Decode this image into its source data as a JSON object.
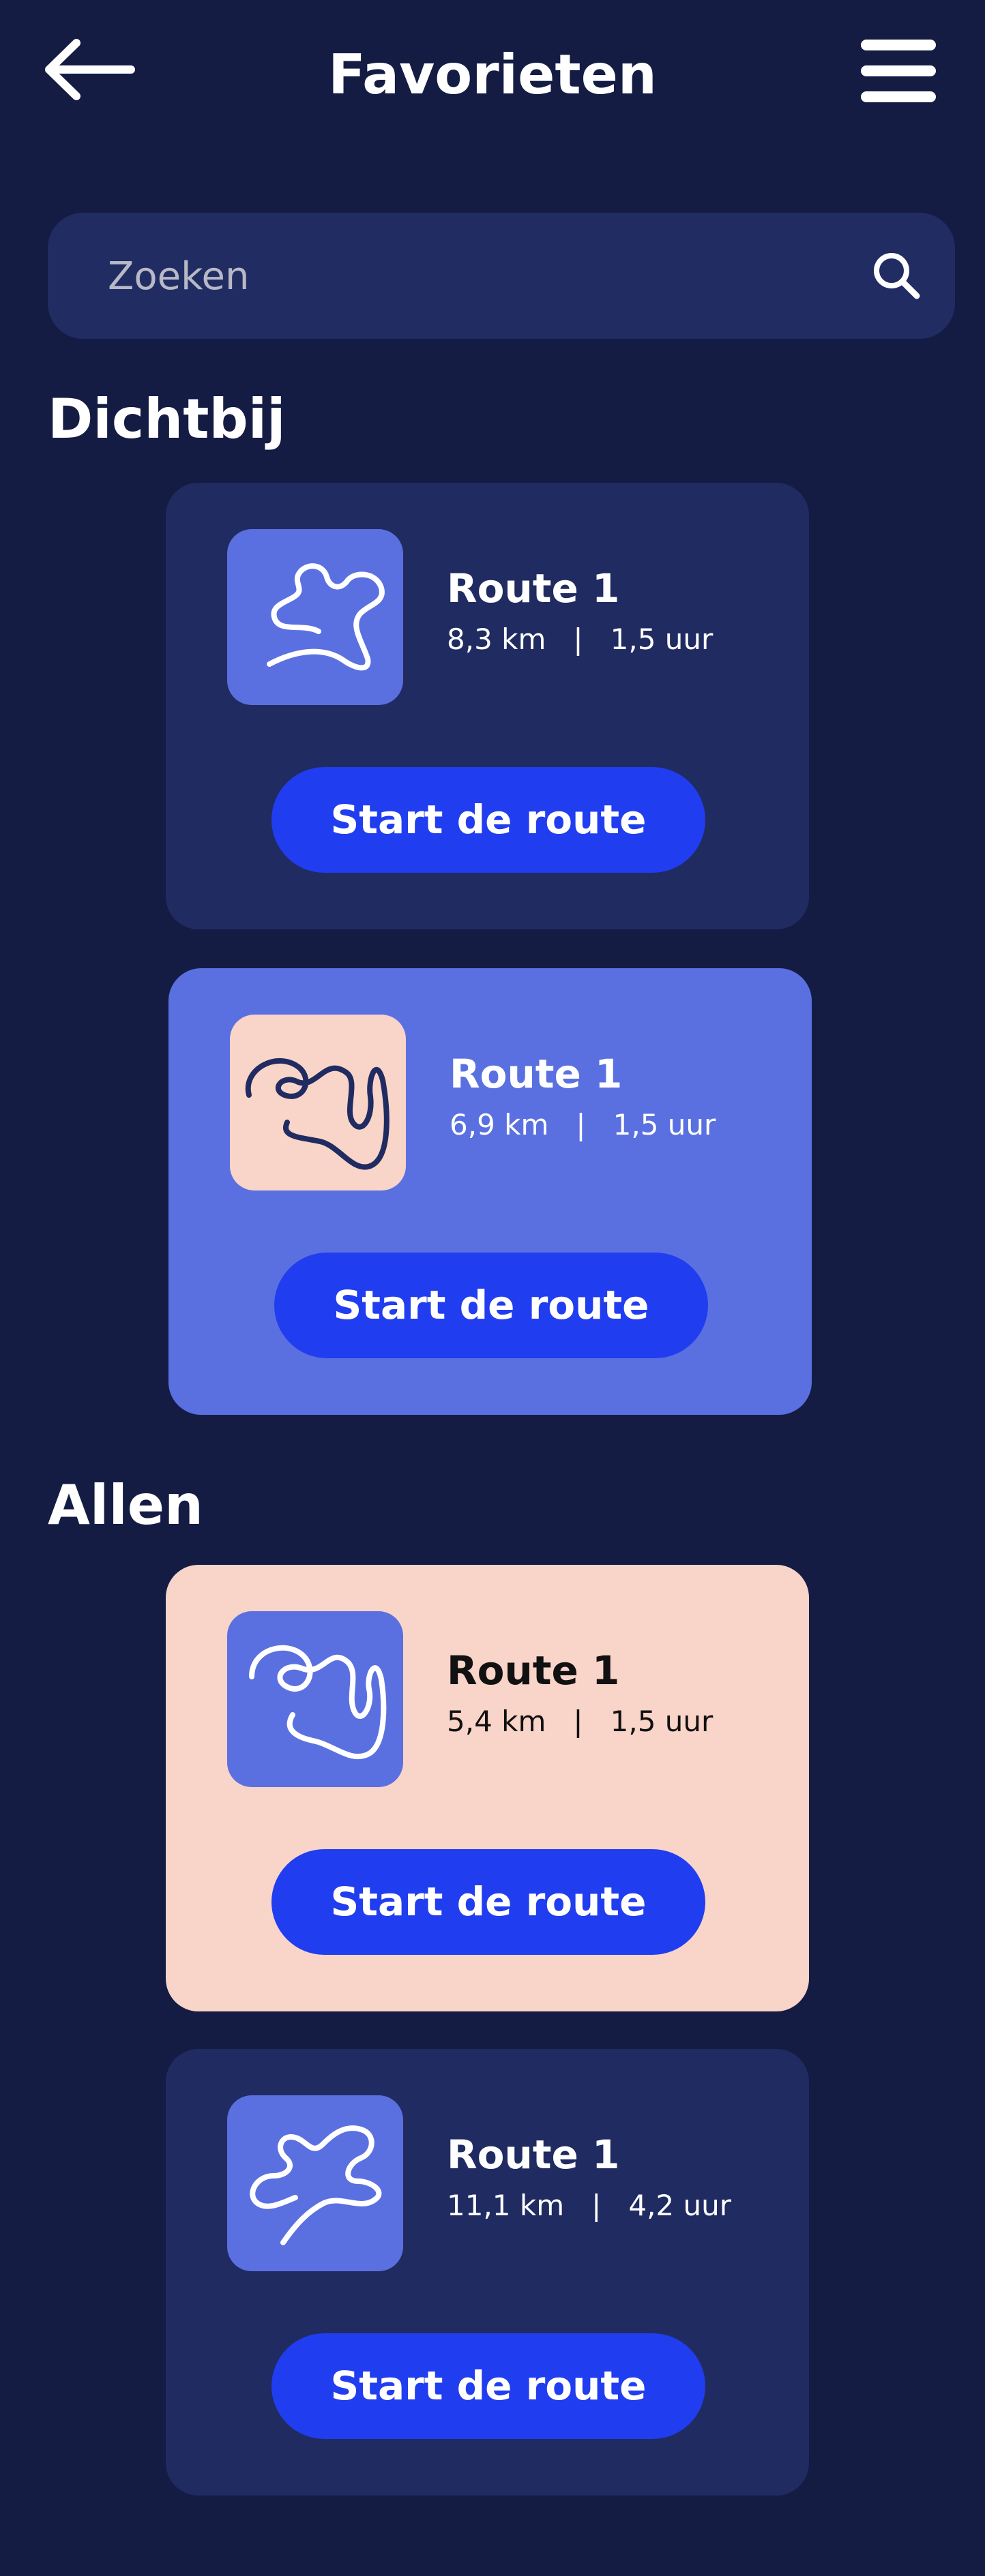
{
  "header": {
    "title": "Favorieten",
    "back_icon": "arrow-left-icon",
    "menu_icon": "hamburger-menu-icon"
  },
  "search": {
    "placeholder": "Zoeken",
    "icon": "search-icon"
  },
  "sections": {
    "nearby": "Dichtbij",
    "all": "Allen"
  },
  "cards": [
    {
      "name": "Route 1",
      "meta": "8,3 km   |   1,5 uur",
      "button": "Start de route",
      "card_color": "#202b61",
      "thumb_color": "#5b70e0",
      "stroke_color": "#ffffff",
      "icon": "route-map-icon"
    },
    {
      "name": "Route 1",
      "meta": "6,9 km   |   1,5 uur",
      "button": "Start de route",
      "card_color": "#5b70e0",
      "thumb_color": "#f9d4c8",
      "stroke_color": "#202b61",
      "icon": "route-map-icon"
    },
    {
      "name": "Route 1",
      "meta": "5,4 km   |   1,5 uur",
      "button": "Start de route",
      "card_color": "#f9d4c8",
      "thumb_color": "#5b70e0",
      "stroke_color": "#ffffff",
      "icon": "route-map-icon",
      "text_color": "#111111"
    },
    {
      "name": "Route 1",
      "meta": "11,1 km   |   4,2 uur",
      "button": "Start de route",
      "card_color": "#202b61",
      "thumb_color": "#5b70e0",
      "stroke_color": "#ffffff",
      "icon": "route-map-icon"
    }
  ],
  "colors": {
    "background": "#141c44",
    "search_bg": "#212c63",
    "button": "#213df0",
    "placeholder": "#b8b9c6"
  }
}
